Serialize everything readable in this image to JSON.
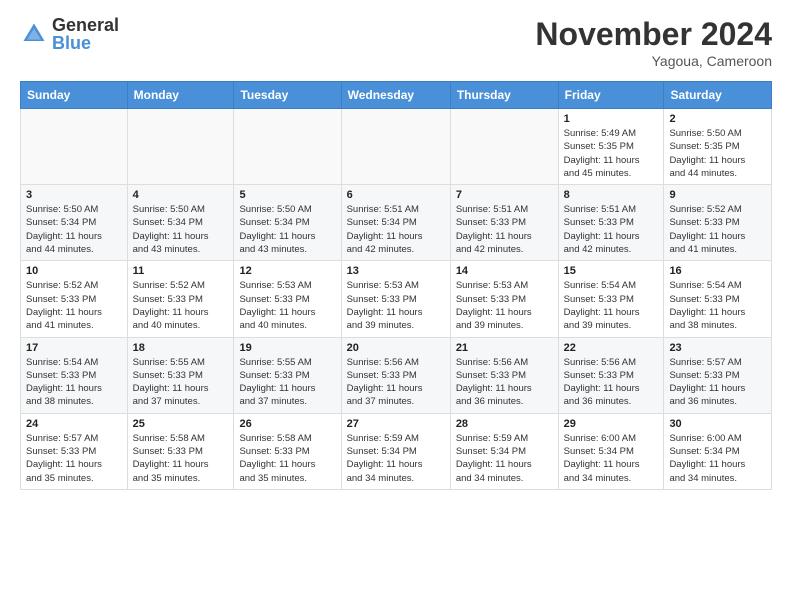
{
  "logo": {
    "general": "General",
    "blue": "Blue"
  },
  "header": {
    "month": "November 2024",
    "location": "Yagoua, Cameroon"
  },
  "weekdays": [
    "Sunday",
    "Monday",
    "Tuesday",
    "Wednesday",
    "Thursday",
    "Friday",
    "Saturday"
  ],
  "weeks": [
    [
      {
        "day": "",
        "info": ""
      },
      {
        "day": "",
        "info": ""
      },
      {
        "day": "",
        "info": ""
      },
      {
        "day": "",
        "info": ""
      },
      {
        "day": "",
        "info": ""
      },
      {
        "day": "1",
        "info": "Sunrise: 5:49 AM\nSunset: 5:35 PM\nDaylight: 11 hours\nand 45 minutes."
      },
      {
        "day": "2",
        "info": "Sunrise: 5:50 AM\nSunset: 5:35 PM\nDaylight: 11 hours\nand 44 minutes."
      }
    ],
    [
      {
        "day": "3",
        "info": "Sunrise: 5:50 AM\nSunset: 5:34 PM\nDaylight: 11 hours\nand 44 minutes."
      },
      {
        "day": "4",
        "info": "Sunrise: 5:50 AM\nSunset: 5:34 PM\nDaylight: 11 hours\nand 43 minutes."
      },
      {
        "day": "5",
        "info": "Sunrise: 5:50 AM\nSunset: 5:34 PM\nDaylight: 11 hours\nand 43 minutes."
      },
      {
        "day": "6",
        "info": "Sunrise: 5:51 AM\nSunset: 5:34 PM\nDaylight: 11 hours\nand 42 minutes."
      },
      {
        "day": "7",
        "info": "Sunrise: 5:51 AM\nSunset: 5:33 PM\nDaylight: 11 hours\nand 42 minutes."
      },
      {
        "day": "8",
        "info": "Sunrise: 5:51 AM\nSunset: 5:33 PM\nDaylight: 11 hours\nand 42 minutes."
      },
      {
        "day": "9",
        "info": "Sunrise: 5:52 AM\nSunset: 5:33 PM\nDaylight: 11 hours\nand 41 minutes."
      }
    ],
    [
      {
        "day": "10",
        "info": "Sunrise: 5:52 AM\nSunset: 5:33 PM\nDaylight: 11 hours\nand 41 minutes."
      },
      {
        "day": "11",
        "info": "Sunrise: 5:52 AM\nSunset: 5:33 PM\nDaylight: 11 hours\nand 40 minutes."
      },
      {
        "day": "12",
        "info": "Sunrise: 5:53 AM\nSunset: 5:33 PM\nDaylight: 11 hours\nand 40 minutes."
      },
      {
        "day": "13",
        "info": "Sunrise: 5:53 AM\nSunset: 5:33 PM\nDaylight: 11 hours\nand 39 minutes."
      },
      {
        "day": "14",
        "info": "Sunrise: 5:53 AM\nSunset: 5:33 PM\nDaylight: 11 hours\nand 39 minutes."
      },
      {
        "day": "15",
        "info": "Sunrise: 5:54 AM\nSunset: 5:33 PM\nDaylight: 11 hours\nand 39 minutes."
      },
      {
        "day": "16",
        "info": "Sunrise: 5:54 AM\nSunset: 5:33 PM\nDaylight: 11 hours\nand 38 minutes."
      }
    ],
    [
      {
        "day": "17",
        "info": "Sunrise: 5:54 AM\nSunset: 5:33 PM\nDaylight: 11 hours\nand 38 minutes."
      },
      {
        "day": "18",
        "info": "Sunrise: 5:55 AM\nSunset: 5:33 PM\nDaylight: 11 hours\nand 37 minutes."
      },
      {
        "day": "19",
        "info": "Sunrise: 5:55 AM\nSunset: 5:33 PM\nDaylight: 11 hours\nand 37 minutes."
      },
      {
        "day": "20",
        "info": "Sunrise: 5:56 AM\nSunset: 5:33 PM\nDaylight: 11 hours\nand 37 minutes."
      },
      {
        "day": "21",
        "info": "Sunrise: 5:56 AM\nSunset: 5:33 PM\nDaylight: 11 hours\nand 36 minutes."
      },
      {
        "day": "22",
        "info": "Sunrise: 5:56 AM\nSunset: 5:33 PM\nDaylight: 11 hours\nand 36 minutes."
      },
      {
        "day": "23",
        "info": "Sunrise: 5:57 AM\nSunset: 5:33 PM\nDaylight: 11 hours\nand 36 minutes."
      }
    ],
    [
      {
        "day": "24",
        "info": "Sunrise: 5:57 AM\nSunset: 5:33 PM\nDaylight: 11 hours\nand 35 minutes."
      },
      {
        "day": "25",
        "info": "Sunrise: 5:58 AM\nSunset: 5:33 PM\nDaylight: 11 hours\nand 35 minutes."
      },
      {
        "day": "26",
        "info": "Sunrise: 5:58 AM\nSunset: 5:33 PM\nDaylight: 11 hours\nand 35 minutes."
      },
      {
        "day": "27",
        "info": "Sunrise: 5:59 AM\nSunset: 5:34 PM\nDaylight: 11 hours\nand 34 minutes."
      },
      {
        "day": "28",
        "info": "Sunrise: 5:59 AM\nSunset: 5:34 PM\nDaylight: 11 hours\nand 34 minutes."
      },
      {
        "day": "29",
        "info": "Sunrise: 6:00 AM\nSunset: 5:34 PM\nDaylight: 11 hours\nand 34 minutes."
      },
      {
        "day": "30",
        "info": "Sunrise: 6:00 AM\nSunset: 5:34 PM\nDaylight: 11 hours\nand 34 minutes."
      }
    ]
  ]
}
